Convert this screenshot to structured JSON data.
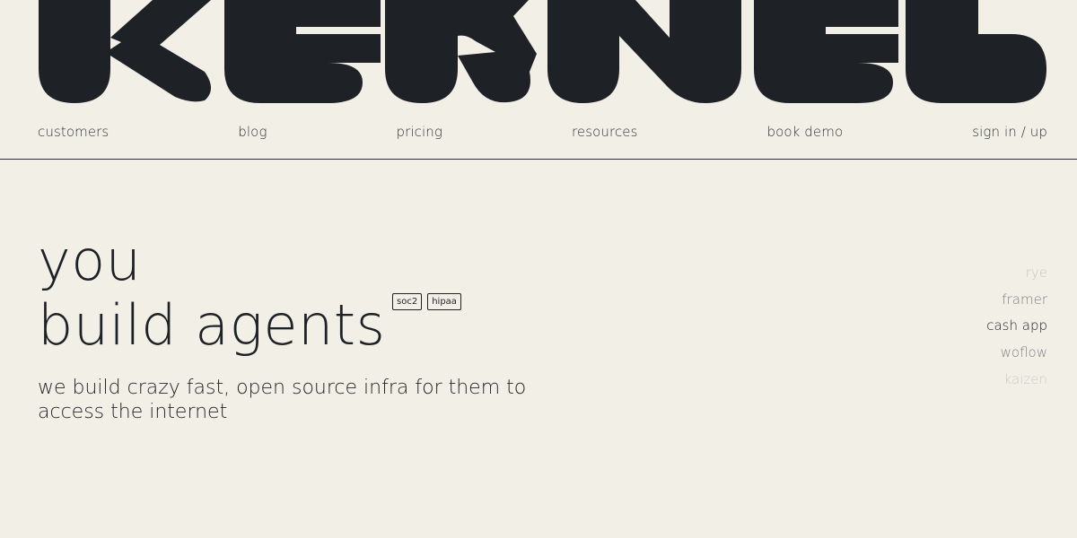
{
  "brand": {
    "name": "KERNEL",
    "color": "#1e2126"
  },
  "nav": {
    "items": [
      {
        "label": "customers"
      },
      {
        "label": "blog"
      },
      {
        "label": "pricing"
      },
      {
        "label": "resources"
      },
      {
        "label": "book demo"
      },
      {
        "label": "sign in / up"
      }
    ]
  },
  "hero": {
    "line1": "you",
    "line2": "build agents",
    "badges": [
      "soc2",
      "hipaa"
    ],
    "subtitle": "we build crazy fast, open source infra for them to access the internet"
  },
  "customers": {
    "items": [
      "rye",
      "framer",
      "cash app",
      "woflow",
      "kaizen"
    ],
    "active": "cash app"
  },
  "colors": {
    "background": "#f2efe7",
    "text": "#1e2126",
    "muted": "#7d7f82",
    "faint": "#c9c6bf"
  }
}
